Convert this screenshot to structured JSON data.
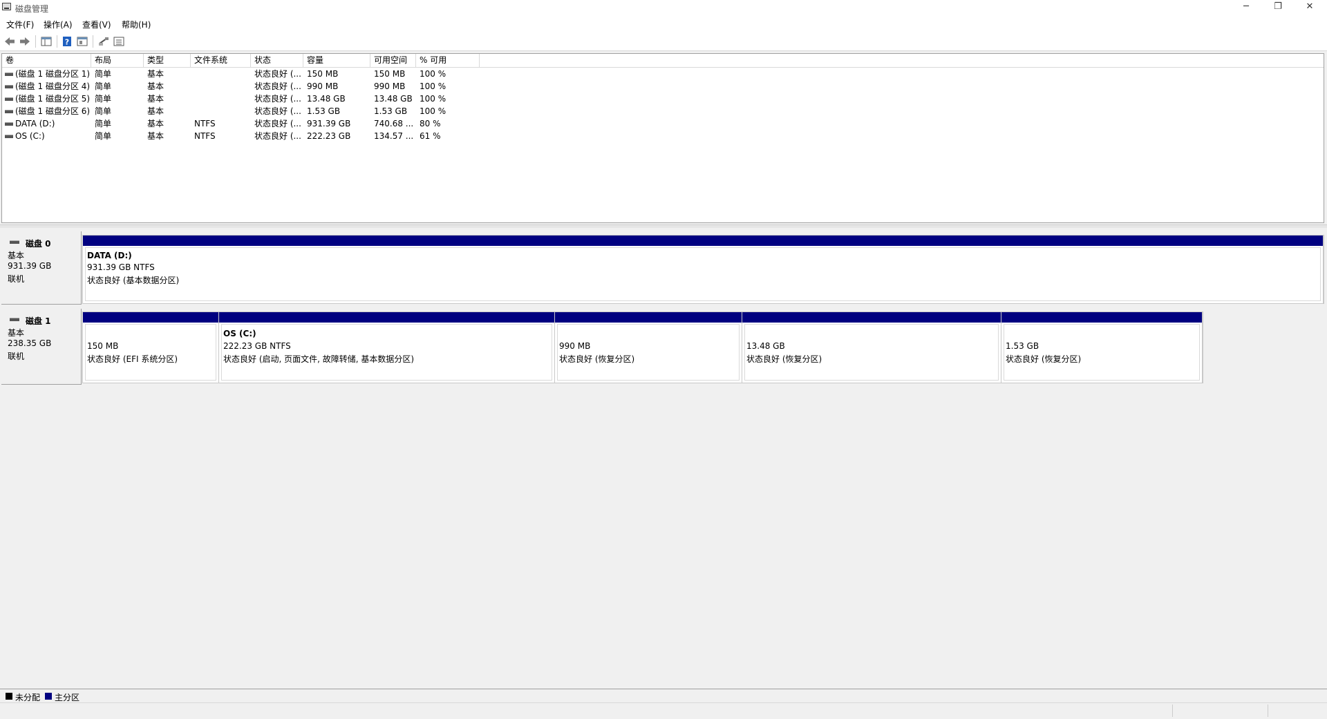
{
  "window": {
    "title": "磁盘管理",
    "minimize_glyph": "─",
    "maximize_glyph": "❐",
    "close_glyph": "✕"
  },
  "menu": [
    {
      "label": "文件(F)"
    },
    {
      "label": "操作(A)"
    },
    {
      "label": "查看(V)"
    },
    {
      "label": "帮助(H)"
    }
  ],
  "toolbar": {
    "icons": [
      "back-arrow-icon",
      "forward-arrow-icon",
      "console-tree-icon",
      "help-icon",
      "properties-icon",
      "rescan-icon",
      "list-view-icon"
    ]
  },
  "volume_list": {
    "columns": [
      "卷",
      "布局",
      "类型",
      "文件系统",
      "状态",
      "容量",
      "可用空间",
      "% 可用"
    ],
    "rows": [
      {
        "volume": "(磁盘 1 磁盘分区 1)",
        "layout": "简单",
        "type": "基本",
        "fs": "",
        "status": "状态良好 (...",
        "capacity": "150 MB",
        "free": "150 MB",
        "pct": "100 %"
      },
      {
        "volume": "(磁盘 1 磁盘分区 4)",
        "layout": "简单",
        "type": "基本",
        "fs": "",
        "status": "状态良好 (...",
        "capacity": "990 MB",
        "free": "990 MB",
        "pct": "100 %"
      },
      {
        "volume": "(磁盘 1 磁盘分区 5)",
        "layout": "简单",
        "type": "基本",
        "fs": "",
        "status": "状态良好 (...",
        "capacity": "13.48 GB",
        "free": "13.48 GB",
        "pct": "100 %"
      },
      {
        "volume": "(磁盘 1 磁盘分区 6)",
        "layout": "简单",
        "type": "基本",
        "fs": "",
        "status": "状态良好 (...",
        "capacity": "1.53 GB",
        "free": "1.53 GB",
        "pct": "100 %"
      },
      {
        "volume": "DATA (D:)",
        "layout": "简单",
        "type": "基本",
        "fs": "NTFS",
        "status": "状态良好 (...",
        "capacity": "931.39 GB",
        "free": "740.68 ...",
        "pct": "80 %"
      },
      {
        "volume": "OS (C:)",
        "layout": "简单",
        "type": "基本",
        "fs": "NTFS",
        "status": "状态良好 (...",
        "capacity": "222.23 GB",
        "free": "134.57 ...",
        "pct": "61 %"
      }
    ]
  },
  "disks": [
    {
      "name": "磁盘 0",
      "kind": "基本",
      "size": "931.39 GB",
      "state": "联机",
      "partitions": [
        {
          "title": "DATA  (D:)",
          "size": "931.39 GB NTFS",
          "status": "状态良好 (基本数据分区)"
        }
      ]
    },
    {
      "name": "磁盘 1",
      "kind": "基本",
      "size": "238.35 GB",
      "state": "联机",
      "partitions": [
        {
          "title": "",
          "size": "150 MB",
          "status": "状态良好 (EFI 系统分区)"
        },
        {
          "title": "OS  (C:)",
          "size": "222.23 GB NTFS",
          "status": "状态良好 (启动, 页面文件, 故障转储, 基本数据分区)"
        },
        {
          "title": "",
          "size": "990 MB",
          "status": "状态良好 (恢复分区)"
        },
        {
          "title": "",
          "size": "13.48 GB",
          "status": "状态良好 (恢复分区)"
        },
        {
          "title": "",
          "size": "1.53 GB",
          "status": "状态良好 (恢复分区)"
        }
      ]
    }
  ],
  "legend": [
    {
      "label": "未分配",
      "color": "#000000"
    },
    {
      "label": "主分区",
      "color": "#000080"
    }
  ]
}
